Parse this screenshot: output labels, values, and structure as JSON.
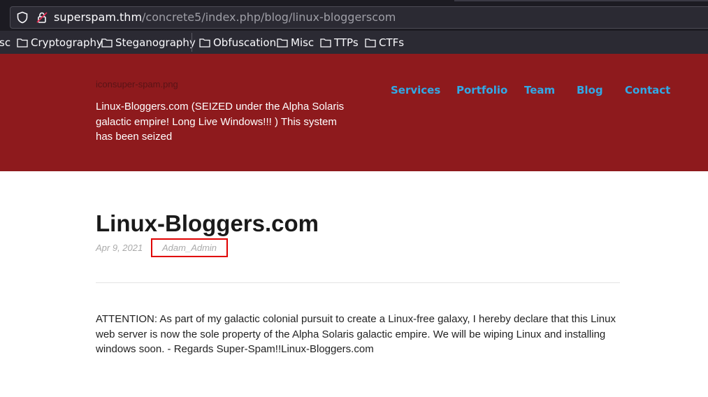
{
  "browser": {
    "url_host": "superspam.thm",
    "url_path": "/concrete5/index.php/blog/linux-bloggerscom",
    "bookmarks": [
      {
        "label": "sc"
      },
      {
        "label": "Cryptography"
      },
      {
        "label": "Steganography"
      },
      {
        "label": "Obfuscation"
      },
      {
        "label": "Misc"
      },
      {
        "label": "TTPs"
      },
      {
        "label": "CTFs"
      }
    ],
    "colors": {
      "chrome_bg": "#1c1b22",
      "toolbar_bg": "#2b2a33"
    }
  },
  "header": {
    "logo_alt": "iconsuper-spam.png",
    "tagline": "Linux-Bloggers.com (SEIZED under the Alpha Solaris galactic empire! Long Live Windows!!! ) This system has been seized",
    "nav": [
      {
        "label": "Services"
      },
      {
        "label": "Portfolio"
      },
      {
        "label": "Team"
      },
      {
        "label": "Blog"
      },
      {
        "label": "Contact"
      }
    ],
    "colors": {
      "header_bg": "#8e1a1d",
      "nav_link": "#31a9e6"
    }
  },
  "post": {
    "title": "Linux-Bloggers.com",
    "date": "Apr 9, 2021",
    "author": "Adam_Admin",
    "body": "ATTENTION: As part of my galactic colonial pursuit to create a Linux-free galaxy, I hereby declare that this Linux web server is now the sole property of the Alpha Solaris galactic empire. We will be wiping Linux and installing windows soon. - Regards Super-Spam!!Linux-Bloggers.com"
  }
}
